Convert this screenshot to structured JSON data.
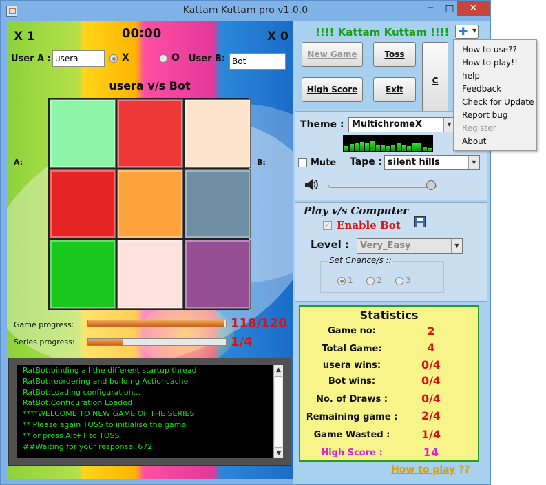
{
  "window": {
    "title": "Kattam Kuttam pro v1.0.0",
    "minimize": "─",
    "maximize": "□",
    "close": "✕"
  },
  "game": {
    "score_a": "X 1",
    "timer": "00:00",
    "score_b": "X 0",
    "user_a_label": "User A :",
    "user_a_value": "usera",
    "symbol_x": "X",
    "symbol_o": "O",
    "user_b_label": "User B:",
    "user_b_value": "Bot",
    "match_title": "usera v/s Bot",
    "side_a_label": "A:",
    "side_b_label": "B:",
    "board_colors": [
      "#8cf5a8",
      "#ee3838",
      "#fce3cc",
      "#e52424",
      "#ffa43c",
      "#6e8fa3",
      "#18c81c",
      "#fce1dc",
      "#944f94"
    ],
    "game_progress_label": "Game progress:",
    "game_progress_value": 0.983,
    "game_progress_text": "118/120",
    "series_progress_label": "Series progress:",
    "series_progress_value": 0.25,
    "series_progress_text": "1/4",
    "console_lines": [
      "RatBot:binding all the different startup thread",
      "RatBot:reordering and building Actioncache",
      "RatBot:Loading  configuration...",
      "RatBot:Configuration Loaded",
      "****WELCOME TO NEW GAME OF THE SERIES",
      "** Please again TOSS to initialise the game",
      "** or press Alt+T to TOSS",
      "",
      "##Waiting for your response: 672"
    ]
  },
  "panel": {
    "app_name": "!!!! Kattam Kuttam !!!!",
    "new_game": "New Game",
    "toss": "Toss",
    "c_button": "C",
    "high_score": "High Score",
    "exit": "Exit",
    "theme_label": "Theme :",
    "theme_value": "MultichromeX",
    "mute_label": "Mute",
    "tape_label": "Tape :",
    "tape_value": "silent hills",
    "volume": 0.95,
    "bot_title": "Play v/s Computer",
    "enable_bot_label": "Enable Bot",
    "level_label": "Level :",
    "level_value": "Very_Easy",
    "chance_label": "Set Chance/s ::",
    "chance_options": [
      "1",
      "2",
      "3"
    ],
    "link_text": "How to play",
    "link_suffix": " ??"
  },
  "stats": {
    "title": "Statistics",
    "rows": [
      {
        "label": "Game no:",
        "value": "2"
      },
      {
        "label": "Total Game:",
        "value": "4"
      },
      {
        "label": "usera wins:",
        "value": "0/4"
      },
      {
        "label": "Bot wins:",
        "value": "0/4"
      },
      {
        "label": "No. of Draws :",
        "value": "0/4"
      },
      {
        "label": "Remaining game :",
        "value": "2/4"
      },
      {
        "label": "Game Wasted :",
        "value": "1/4"
      },
      {
        "label": "High Score :",
        "value": "14"
      }
    ]
  },
  "menu": {
    "items": [
      "How to use??",
      "How to play!!",
      "help",
      "Feedback",
      "Check for Update",
      "Report bug",
      "Register",
      "About"
    ]
  },
  "visualizer": {
    "levels": [
      0.3,
      0.45,
      0.55,
      0.6,
      0.5,
      0.7,
      0.4,
      0.35,
      0.3,
      0.4,
      0.55,
      0.35,
      0.3,
      0.5,
      0.55,
      0.25,
      0.2
    ]
  }
}
